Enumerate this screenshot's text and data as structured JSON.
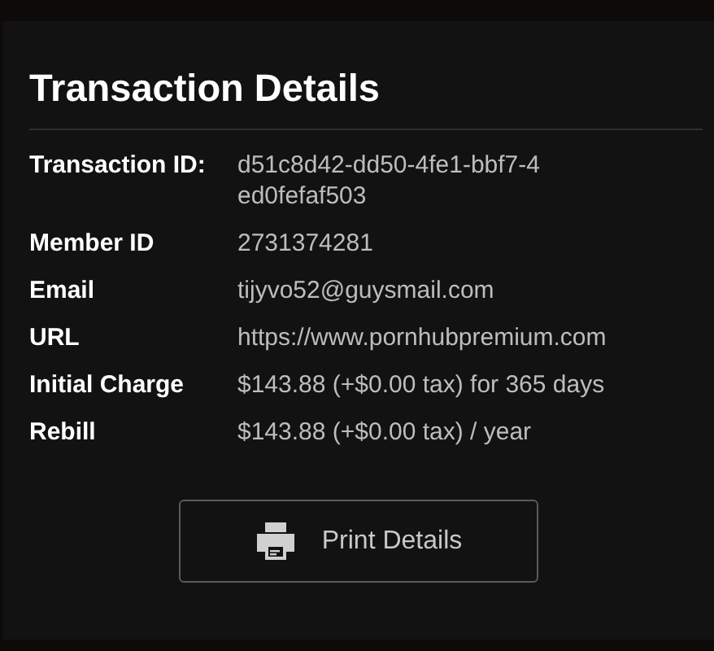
{
  "dialog": {
    "title": "Transaction Details",
    "fields": [
      {
        "label": "Transaction ID:",
        "value": "d51c8d42-dd50-4fe1-bbf7-4ed0fefaf503"
      },
      {
        "label": "Member ID",
        "value": "2731374281"
      },
      {
        "label": "Email",
        "value": "tijyvo52@guysmail.com"
      },
      {
        "label": "URL",
        "value": "https://www.pornhubpremium.com"
      },
      {
        "label": "Initial Charge",
        "value": "$143.88 (+$0.00 tax) for 365 days"
      },
      {
        "label": "Rebill",
        "value": "$143.88 (+$0.00 tax) / year"
      }
    ],
    "button": {
      "label": "Print Details"
    }
  }
}
